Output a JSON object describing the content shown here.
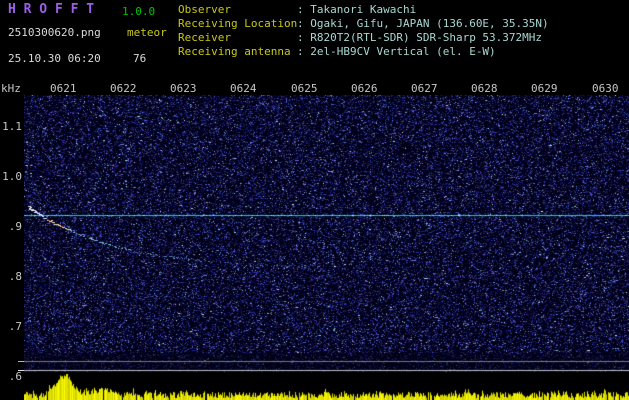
{
  "header": {
    "app_title": "H R O F F T",
    "version": "1.0.0",
    "filename": "2510300620.png",
    "mode": "meteor",
    "datetime": "25.10.30 06:20",
    "count": "76",
    "info_rows": [
      {
        "label": "Observer",
        "sep": ": ",
        "value": "Takanori Kawachi"
      },
      {
        "label": "Receiving Location",
        "sep": ": ",
        "value": "Ogaki, Gifu, JAPAN (136.60E, 35.35N)"
      },
      {
        "label": "Receiver",
        "sep": ": ",
        "value": "R820T2(RTL-SDR) SDR-Sharp 53.372MHz"
      },
      {
        "label": "Receiving antenna",
        "sep": ": ",
        "value": "2el-HB9CV Vertical (el. E-W)"
      }
    ]
  },
  "axes": {
    "freq_unit": "kHz",
    "time_ticks": [
      "0621",
      "0622",
      "0623",
      "0624",
      "0625",
      "0626",
      "0627",
      "0628",
      "0629",
      "0630"
    ],
    "freq_ticks": [
      "1.1",
      "1.0",
      ".9",
      ".8",
      ".7",
      ".6"
    ]
  },
  "chart_data": {
    "type": "heatmap",
    "subtype": "radio-meteor-spectrogram",
    "x_ticks": [
      "0621",
      "0622",
      "0623",
      "0624",
      "0625",
      "0626",
      "0627",
      "0628",
      "0629",
      "0630"
    ],
    "y_unit": "kHz",
    "y_ticks": [
      1.1,
      1.0,
      0.9,
      0.8,
      0.7,
      0.6
    ],
    "y_range": [
      0.55,
      1.17
    ],
    "background": "dark blue random noise field",
    "carrier_line_khz": 0.92,
    "meteor_echo": {
      "shape": "bright head echo near 0620.5 with descending doppler curve fading to the right",
      "points_min_offset_khz": [
        [
          0.4,
          0.94
        ],
        [
          0.9,
          0.91
        ],
        [
          1.5,
          0.88
        ],
        [
          2.3,
          0.855
        ],
        [
          3.3,
          0.84
        ],
        [
          4.3,
          0.828
        ],
        [
          5.1,
          0.823
        ]
      ]
    },
    "signal_level_bars": {
      "description": "yellow per-second signal level bars along bottom strip",
      "peak_minute_offset": 0.7
    }
  },
  "render": {
    "seed": 20251030,
    "carrier_y": 215,
    "trace": {
      "x_start": 28,
      "x_end": 312,
      "asymptote_y": 268,
      "amplitude": 60,
      "tau": 85
    },
    "band": {
      "top": 353,
      "height": 19
    },
    "level_lines": [
      {
        "y": 361,
        "color": "rgba(170,170,170,0.7)"
      },
      {
        "y": 370,
        "color": "rgba(235,235,235,0.8)"
      }
    ],
    "bars": {
      "peak_x": 64,
      "peak_amp": 19,
      "peak2_x": 100,
      "peak2_amp": 5
    }
  },
  "colors": {
    "title": "#9b5fe8",
    "version": "#00c400",
    "label_yellow": "#c8c81a",
    "value_cyan": "#a8d8d2",
    "text_white": "#dadada",
    "axis_text": "#c6c6c6",
    "carrier": "#00d4de",
    "bar_yellow": "#d8d800",
    "noise_bg": "#000019"
  }
}
